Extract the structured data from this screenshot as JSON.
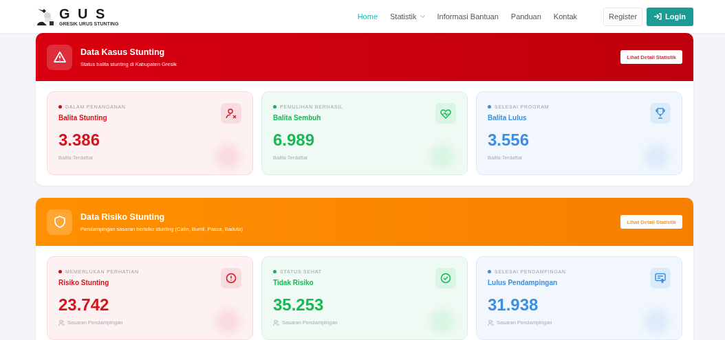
{
  "brand": {
    "title": "G U S",
    "subtitle": "GRESIK URUS STUNTING"
  },
  "nav": [
    {
      "label": "Home",
      "selected": true,
      "dropdown": false
    },
    {
      "label": "Statistik",
      "selected": false,
      "dropdown": true
    },
    {
      "label": "Informasi Bantuan",
      "selected": false,
      "dropdown": false
    },
    {
      "label": "Panduan",
      "selected": false,
      "dropdown": false
    },
    {
      "label": "Kontak",
      "selected": false,
      "dropdown": false
    }
  ],
  "auth": {
    "register": "Register",
    "login": "Login"
  },
  "sections": [
    {
      "kind": "cases",
      "title": "Data Kasus Stunting",
      "subtitle": "Status balita stunting di Kabupaten Gresik",
      "button": "Lihat Detail Statistik",
      "cards": [
        {
          "kind": "danger",
          "status": "DALAM PENANGANAN",
          "title": "Balita Stunting",
          "value": "3.386",
          "footer": "Balita Terdaftar"
        },
        {
          "kind": "success",
          "status": "PEMULIHAN BERHASIL",
          "title": "Balita Sembuh",
          "value": "6.989",
          "footer": "Balita Terdaftar"
        },
        {
          "kind": "info",
          "status": "SELESAI PROGRAM",
          "title": "Balita Lulus",
          "value": "3.556",
          "footer": "Balita Terdaftar"
        }
      ]
    },
    {
      "kind": "risk",
      "title": "Data Risiko Stunting",
      "subtitle": "Pendampingan sasaran berisiko stunting (Catin, Bumil, Pasca, Baduta)",
      "button": "Lihat Detail Statistik",
      "cards": [
        {
          "kind": "danger",
          "status": "MEMERLUKAN PERHATIAN",
          "title": "Risiko Stunting",
          "value": "23.742",
          "footer": "Sasaran Pendampingan"
        },
        {
          "kind": "success",
          "status": "STATUS SEHAT",
          "title": "Tidak Risiko",
          "value": "35.253",
          "footer": "Sasaran Pendampingan"
        },
        {
          "kind": "info",
          "status": "SELESAI PENDAMPINGAN",
          "title": "Lulus Pendampingan",
          "value": "31.938",
          "footer": "Sasaran Pendampingan"
        }
      ]
    }
  ]
}
